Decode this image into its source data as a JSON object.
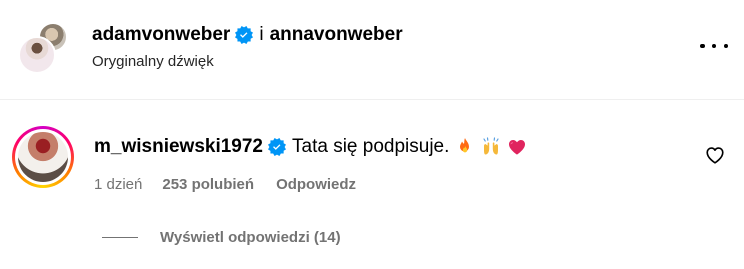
{
  "header": {
    "author_primary": "adamvonweber",
    "joiner": "i",
    "author_secondary": "annavonweber",
    "audio_label": "Oryginalny dźwięk",
    "more_icon": "more-horizontal-icon"
  },
  "comment": {
    "username": "m_wisniewski1972",
    "verified": true,
    "text": "Tata się podpisuje.",
    "emojis": [
      "fire",
      "raising-hands",
      "heart"
    ],
    "time": "1 dzień",
    "likes": "253 polubień",
    "reply_label": "Odpowiedz",
    "like_icon": "heart-outline-icon",
    "view_replies": "Wyświetl odpowiedzi (14)"
  },
  "colors": {
    "verified": "#0095f6",
    "muted_text": "#737373",
    "divider": "#efefef"
  }
}
